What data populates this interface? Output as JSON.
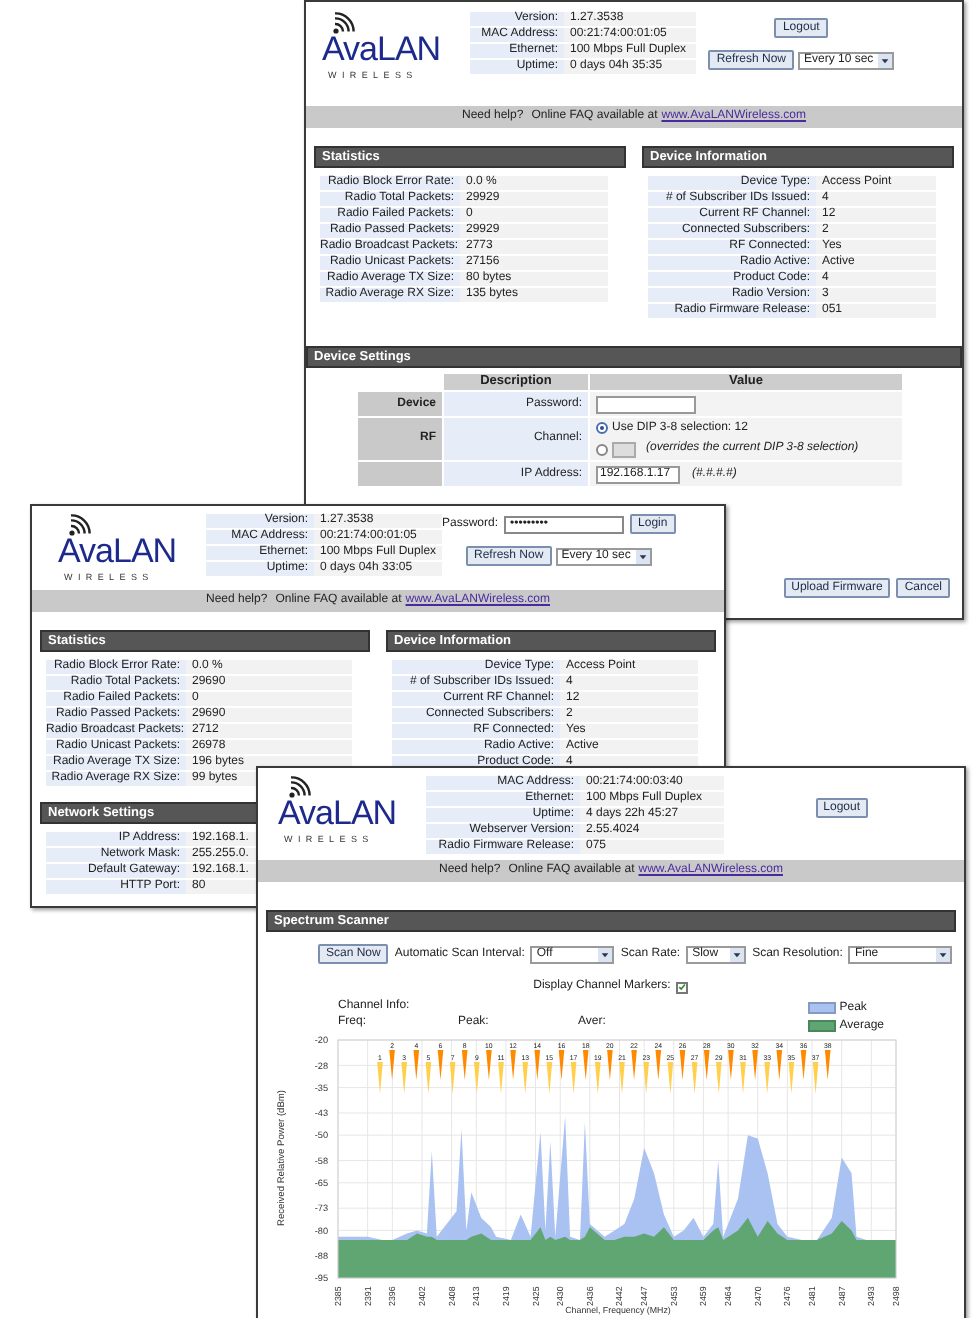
{
  "windows": [
    {
      "logo": {
        "brand": "AvaLAN",
        "tagline": "WIRELESS"
      },
      "info": [
        {
          "label": "Version:",
          "value": "1.27.3538"
        },
        {
          "label": "MAC Address:",
          "value": "00:21:74:00:01:05"
        },
        {
          "label": "Ethernet:",
          "value": "100 Mbps Full Duplex"
        },
        {
          "label": "Uptime:",
          "value": "0 days 04h 35:35"
        }
      ],
      "logout": "Logout",
      "refresh": {
        "button": "Refresh Now",
        "interval": "Every 10 sec"
      },
      "help": {
        "question": "Need help?",
        "text": "Online FAQ available at",
        "link": "www.AvaLANWireless.com"
      },
      "columns": [
        [
          {
            "title": "Statistics",
            "rows": [
              {
                "label": "Radio Block Error Rate:",
                "value": "0.0 %"
              },
              {
                "label": "Radio Total Packets:",
                "value": "29929"
              },
              {
                "label": "Radio Failed Packets:",
                "value": "0"
              },
              {
                "label": "Radio Passed Packets:",
                "value": "29929"
              },
              {
                "label": "Radio Broadcast Packets:",
                "value": "2773"
              },
              {
                "label": "Radio Unicast Packets:",
                "value": "27156"
              },
              {
                "label": "Radio Average TX Size:",
                "value": "80 bytes"
              },
              {
                "label": "Radio Average RX Size:",
                "value": "135 bytes"
              }
            ]
          }
        ],
        [
          {
            "title": "Device Information",
            "rows": [
              {
                "label": "Device Type:",
                "value": "Access Point"
              },
              {
                "label": "# of Subscriber IDs Issued:",
                "value": "4"
              },
              {
                "label": "Current RF Channel:",
                "value": "12"
              },
              {
                "label": "Connected Subscribers:",
                "value": "2"
              },
              {
                "label": "RF Connected:",
                "value": "Yes"
              },
              {
                "label": "Radio Active:",
                "value": "Active"
              },
              {
                "label": "Product Code:",
                "value": "4"
              },
              {
                "label": "Radio Version:",
                "value": "3"
              },
              {
                "label": "Radio Firmware Release:",
                "value": "051"
              }
            ]
          }
        ]
      ],
      "device_settings": {
        "title": "Device Settings",
        "columns": [
          "Description",
          "Value"
        ],
        "groups": [
          {
            "name": "Device",
            "rows": [
              {
                "kind": "password",
                "label": "Password:"
              }
            ]
          },
          {
            "name": "RF",
            "rows": [
              {
                "kind": "channel",
                "label": "Channel:",
                "options": [
                  {
                    "label": "Use DIP 3-8 selection: 12",
                    "selected": true
                  },
                  {
                    "note": "(overrides the current DIP 3-8 selection)",
                    "selected": false
                  }
                ]
              }
            ]
          },
          {
            "rows": [
              {
                "kind": "address",
                "label": "IP Address:",
                "value": "192.168.1.17",
                "hint": "(#.#.#.#)"
              }
            ]
          }
        ],
        "buttons": [
          "Upload Firmware",
          "Cancel"
        ]
      }
    },
    {
      "logo": {
        "brand": "AvaLAN",
        "tagline": "WIRELESS"
      },
      "info": [
        {
          "label": "Version:",
          "value": "1.27.3538"
        },
        {
          "label": "MAC Address:",
          "value": "00:21:74:00:01:05"
        },
        {
          "label": "Ethernet:",
          "value": "100 Mbps Full Duplex"
        },
        {
          "label": "Uptime:",
          "value": "0 days 04h 33:05"
        }
      ],
      "login": {
        "label": "Password:",
        "value": "•••••••••",
        "button": "Login"
      },
      "refresh": {
        "button": "Refresh Now",
        "interval": "Every 10 sec"
      },
      "help": {
        "question": "Need help?",
        "text": "Online FAQ available at",
        "link": "www.AvaLANWireless.com"
      },
      "columns": [
        [
          {
            "title": "Statistics",
            "rows": [
              {
                "label": "Radio Block Error Rate:",
                "value": "0.0 %"
              },
              {
                "label": "Radio Total Packets:",
                "value": "29690"
              },
              {
                "label": "Radio Failed Packets:",
                "value": "0"
              },
              {
                "label": "Radio Passed Packets:",
                "value": "29690"
              },
              {
                "label": "Radio Broadcast Packets:",
                "value": "2712"
              },
              {
                "label": "Radio Unicast Packets:",
                "value": "26978"
              },
              {
                "label": "Radio Average TX Size:",
                "value": "196 bytes"
              },
              {
                "label": "Radio Average RX Size:",
                "value": "99 bytes"
              }
            ]
          },
          {
            "title": "Network Settings",
            "rows": [
              {
                "label": "IP Address:",
                "value": "192.168.1."
              },
              {
                "label": "Network Mask:",
                "value": "255.255.0."
              },
              {
                "label": "Default Gateway:",
                "value": "192.168.1."
              },
              {
                "label": "HTTP Port:",
                "value": "80"
              }
            ]
          }
        ],
        [
          {
            "title": "Device Information",
            "rows": [
              {
                "label": "Device Type:",
                "value": "Access Point"
              },
              {
                "label": "# of Subscriber IDs Issued:",
                "value": "4"
              },
              {
                "label": "Current RF Channel:",
                "value": "12"
              },
              {
                "label": "Connected Subscribers:",
                "value": "2"
              },
              {
                "label": "RF Connected:",
                "value": "Yes"
              },
              {
                "label": "Radio Active:",
                "value": "Active"
              },
              {
                "label": "Product Code:",
                "value": "4"
              }
            ]
          }
        ]
      ]
    },
    {
      "logo": {
        "brand": "AvaLAN",
        "tagline": "WIRELESS"
      },
      "info": [
        {
          "label": "MAC Address:",
          "value": "00:21:74:00:03:40"
        },
        {
          "label": "Ethernet:",
          "value": "100 Mbps Full Duplex"
        },
        {
          "label": "Uptime:",
          "value": "4 days 22h 45:27"
        },
        {
          "label": "Webserver Version:",
          "value": "2.55.4024"
        },
        {
          "label": "Radio Firmware Release:",
          "value": "075"
        }
      ],
      "logout": "Logout",
      "help": {
        "question": "Need help?",
        "text": "Online FAQ available at",
        "link": "www.AvaLANWireless.com"
      },
      "scanner": {
        "title": "Spectrum Scanner",
        "scan_button": "Scan Now",
        "settings": [
          {
            "label": "Automatic Scan Interval:",
            "value": "Off"
          },
          {
            "label": "Scan Rate:",
            "value": "Slow"
          },
          {
            "label": "Scan Resolution:",
            "value": "Fine"
          }
        ],
        "markers_toggle": {
          "label": "Display Channel Markers:",
          "checked": true
        },
        "channel_info": {
          "title": "Channel Info:",
          "fields": [
            "Freq:",
            "Peak:",
            "Aver:"
          ]
        },
        "channel_markers": [
          {
            "label": "1",
            "color": "#ffd04d"
          },
          {
            "label": "2",
            "color": "#ff8a00"
          },
          {
            "label": "3",
            "color": "#ffd04d"
          },
          {
            "label": "4",
            "color": "#ff8a00"
          },
          {
            "label": "5",
            "color": "#ffd04d"
          },
          {
            "label": "6",
            "color": "#ff8a00"
          },
          {
            "label": "7",
            "color": "#ffd04d"
          },
          {
            "label": "8",
            "color": "#ff8a00"
          },
          {
            "label": "9",
            "color": "#ffd04d"
          },
          {
            "label": "10",
            "color": "#ff8a00"
          },
          {
            "label": "11",
            "color": "#ffd04d"
          },
          {
            "label": "12",
            "color": "#ff8a00"
          },
          {
            "label": "13",
            "color": "#ffd04d"
          },
          {
            "label": "14",
            "color": "#ff8a00"
          },
          {
            "label": "15",
            "color": "#ffd04d"
          },
          {
            "label": "16",
            "color": "#ff8a00"
          },
          {
            "label": "17",
            "color": "#ffd04d"
          },
          {
            "label": "18",
            "color": "#ff8a00"
          },
          {
            "label": "19",
            "color": "#ffd04d"
          },
          {
            "label": "20",
            "color": "#ff8a00"
          },
          {
            "label": "21",
            "color": "#ffd04d"
          },
          {
            "label": "22",
            "color": "#ff8a00"
          },
          {
            "label": "23",
            "color": "#ffd04d"
          },
          {
            "label": "24",
            "color": "#ff8a00"
          },
          {
            "label": "25",
            "color": "#ffd04d"
          },
          {
            "label": "26",
            "color": "#ff8a00"
          },
          {
            "label": "27",
            "color": "#ffd04d"
          },
          {
            "label": "28",
            "color": "#ff8a00"
          },
          {
            "label": "29",
            "color": "#ffd04d"
          },
          {
            "label": "30",
            "color": "#ff8a00"
          },
          {
            "label": "31",
            "color": "#ffd04d"
          },
          {
            "label": "32",
            "color": "#ff8a00"
          },
          {
            "label": "33",
            "color": "#ffd04d"
          },
          {
            "label": "34",
            "color": "#ff8a00"
          },
          {
            "label": "35",
            "color": "#ffd04d"
          },
          {
            "label": "36",
            "color": "#ff8a00"
          },
          {
            "label": "37",
            "color": "#ffd04d"
          },
          {
            "label": "38",
            "color": "#ff8a00"
          }
        ],
        "chart_data": {
          "type": "area",
          "xlabel": "Channel, Frequency (MHz)",
          "ylabel": "Received Relative Power (dBm)",
          "x": [
            2385,
            2385,
            2388,
            2391,
            2394,
            2396,
            2399,
            2401,
            2403,
            2404,
            2405,
            2407,
            2409,
            2410,
            2411,
            2412,
            2414,
            2416,
            2417,
            2420,
            2422,
            2424,
            2426,
            2427,
            2428,
            2429,
            2431,
            2432,
            2434,
            2435,
            2436,
            2439,
            2441,
            2443,
            2445,
            2447,
            2449,
            2451,
            2453,
            2455,
            2457,
            2459,
            2461,
            2462,
            2463,
            2466,
            2468,
            2470,
            2472,
            2474,
            2476,
            2479,
            2482,
            2485,
            2487,
            2489,
            2490,
            2492,
            2498,
            2498
          ],
          "series": [
            {
              "name": "Peak",
              "color": "#a9c2f2",
              "values": [
                -95,
                -82,
                -82,
                -82,
                -83,
                -83,
                -81,
                -80,
                -81,
                -55,
                -82,
                -78,
                -74,
                -48,
                -80,
                -68,
                -76,
                -79,
                -82,
                -83,
                -75,
                -82,
                -49,
                -80,
                -52,
                -82,
                -44,
                -82,
                -83,
                -46,
                -78,
                -82,
                -80,
                -78,
                -70,
                -54,
                -62,
                -75,
                -82,
                -80,
                -76,
                -82,
                -78,
                -58,
                -82,
                -70,
                -50,
                -51,
                -62,
                -78,
                -82,
                -83,
                -83,
                -76,
                -57,
                -62,
                -82,
                -83,
                -83,
                -95
              ]
            },
            {
              "name": "Average",
              "color": "#5fa672",
              "values": [
                -95,
                -83,
                -83,
                -83,
                -83,
                -83,
                -83,
                -81,
                -82,
                -82,
                -83,
                -83,
                -83,
                -83,
                -83,
                -82,
                -81,
                -83,
                -83,
                -83,
                -83,
                -83,
                -79,
                -83,
                -82,
                -83,
                -82,
                -83,
                -83,
                -82,
                -79,
                -83,
                -83,
                -82,
                -82,
                -81,
                -82,
                -79,
                -83,
                -83,
                -83,
                -83,
                -80,
                -79,
                -83,
                -80,
                -76,
                -82,
                -77,
                -81,
                -83,
                -83,
                -83,
                -81,
                -77,
                -80,
                -83,
                -83,
                -83,
                -95
              ]
            }
          ],
          "xlim": [
            2385,
            2498
          ],
          "ylim": [
            -95,
            -20
          ],
          "grid": true,
          "xticks": [
            2385,
            2391,
            2396,
            2402,
            2408,
            2413,
            2419,
            2425,
            2430,
            2436,
            2442,
            2447,
            2453,
            2459,
            2464,
            2470,
            2476,
            2481,
            2487,
            2493,
            2498
          ],
          "yticks": [
            -20,
            -28,
            -35,
            -43,
            -50,
            -58,
            -65,
            -73,
            -80,
            -88,
            -95
          ]
        }
      }
    }
  ]
}
